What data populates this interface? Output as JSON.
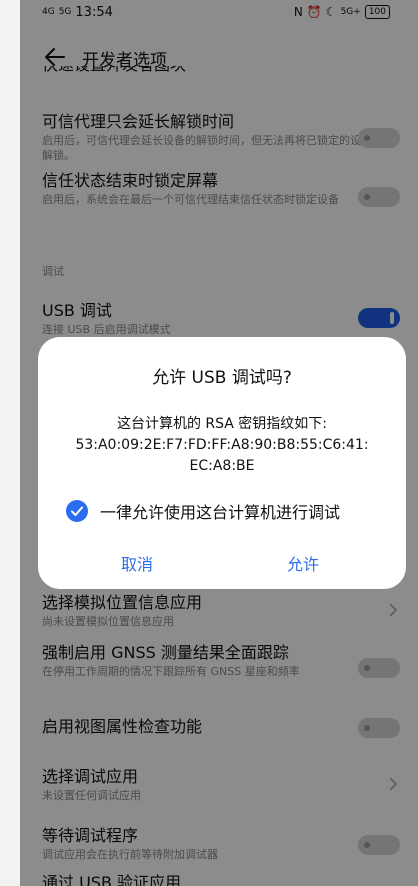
{
  "status": {
    "signal1": "4G",
    "signal2": "5G",
    "time": "13:54",
    "nfc": "N",
    "alarm": "⏰",
    "moon": "☾",
    "net": "5G+",
    "battery": "100"
  },
  "header": {
    "title": "开发者选项"
  },
  "list": {
    "clipped_text": "快速设置开发者图块",
    "trust_extend": {
      "title": "可信代理只会延长解锁时间",
      "desc": "启用后，可信代理会延长设备的解锁时间，但无法再将已锁定的设备解锁。"
    },
    "trust_lock": {
      "title": "信任状态结束时锁定屏幕",
      "desc": "启用后，系统会在最后一个可信代理结束信任状态时锁定设备"
    },
    "section_debug": "调试",
    "usb_debug": {
      "title": "USB 调试",
      "desc": "连接 USB 后启用调试模式"
    },
    "mock_location": {
      "title": "选择模拟位置信息应用",
      "desc": "尚未设置模拟位置信息应用"
    },
    "gnss": {
      "title": "强制启用 GNSS 测量结果全面跟踪",
      "desc": "在停用工作周期的情况下跟踪所有 GNSS 星座和频率"
    },
    "view_attr": {
      "title": "启用视图属性检查功能"
    },
    "debug_app": {
      "title": "选择调试应用",
      "desc": "未设置任何调试应用"
    },
    "wait_debugger": {
      "title": "等待调试程序",
      "desc": "调试应用会在执行前等待附加调试器"
    },
    "verify_usb": {
      "title": "通过 USB 验证应用"
    }
  },
  "dialog": {
    "title": "允许 USB 调试吗?",
    "message_line1": "这台计算机的 RSA 密钥指纹如下:",
    "message_line2": "53:A0:09:2E:F7:FD:FF:A8:90:B8:55:C6:41:",
    "message_line3": "EC:A8:BE",
    "checkbox_label": "一律允许使用这台计算机进行调试",
    "checkbox_checked": true,
    "cancel_label": "取消",
    "ok_label": "允许"
  },
  "colors": {
    "accent": "#2b6cf0",
    "toggle_on": "#1f5ee8"
  }
}
